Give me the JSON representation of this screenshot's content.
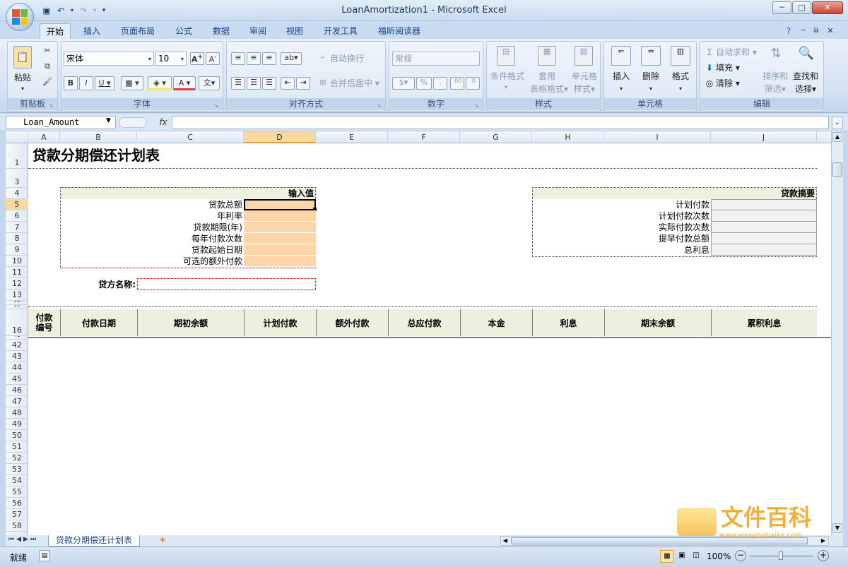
{
  "window": {
    "title": "LoanAmortization1 - Microsoft Excel"
  },
  "quick_access": {
    "save_icon": "save-icon",
    "undo_icon": "undo-icon",
    "redo_icon": "redo-icon"
  },
  "tabs": [
    "开始",
    "插入",
    "页面布局",
    "公式",
    "数据",
    "审阅",
    "视图",
    "开发工具",
    "福昕阅读器"
  ],
  "ribbon": {
    "clipboard": {
      "label": "剪贴板",
      "paste": "粘贴"
    },
    "font": {
      "label": "字体",
      "family": "宋体",
      "size": "10"
    },
    "alignment": {
      "label": "对齐方式",
      "wrap": "自动换行",
      "merge": "合并后居中"
    },
    "number": {
      "label": "数字",
      "format": "常规"
    },
    "styles": {
      "label": "样式",
      "conditional_1": "条件格式",
      "table_1": "套用",
      "table_2": "表格格式",
      "cell_1": "单元格",
      "cell_2": "样式"
    },
    "cells": {
      "label": "单元格",
      "insert": "插入",
      "delete": "删除",
      "format": "格式"
    },
    "editing": {
      "label": "编辑",
      "autosum": "自动求和",
      "fill": "填充",
      "clear": "清除",
      "sort_1": "排序和",
      "sort_2": "筛选",
      "find_1": "查找和",
      "find_2": "选择"
    }
  },
  "formula_bar": {
    "name_box": "Loan_Amount",
    "fx": "fx",
    "value": ""
  },
  "columns": [
    "A",
    "B",
    "C",
    "D",
    "E",
    "F",
    "G",
    "H",
    "I",
    "J"
  ],
  "rows": [
    "1",
    "3",
    "4",
    "5",
    "6",
    "7",
    "8",
    "9",
    "10",
    "11",
    "12",
    "13",
    "14",
    "15",
    "16",
    "41",
    "42",
    "43",
    "44",
    "45",
    "46",
    "47",
    "48",
    "49",
    "50",
    "51",
    "52",
    "53",
    "54",
    "55",
    "56",
    "57",
    "58"
  ],
  "sheet": {
    "title": "贷款分期偿还计划表",
    "input_header": "输入值",
    "input_labels": [
      "贷款总额",
      "年利率",
      "贷款期限(年)",
      "每年付款次数",
      "贷款起始日期",
      "可选的额外付款"
    ],
    "summary_header": "贷款摘要",
    "summary_labels": [
      "计划付款",
      "计划付款次数",
      "实际付款次数",
      "提早付款总额",
      "总利息"
    ],
    "lender_label": "贷方名称:",
    "table_headers": [
      [
        "付款",
        "编号"
      ],
      "付款日期",
      "期初余额",
      "计划付款",
      "额外付款",
      "总应付款",
      "本金",
      "利息",
      "期末余额",
      "累积利息"
    ]
  },
  "sheet_tab": "贷款分期偿还计划表",
  "status": {
    "ready": "就绪",
    "zoom": "100%"
  },
  "watermark": {
    "text": "文件百科",
    "url": "www.wenjinabaike.com"
  }
}
